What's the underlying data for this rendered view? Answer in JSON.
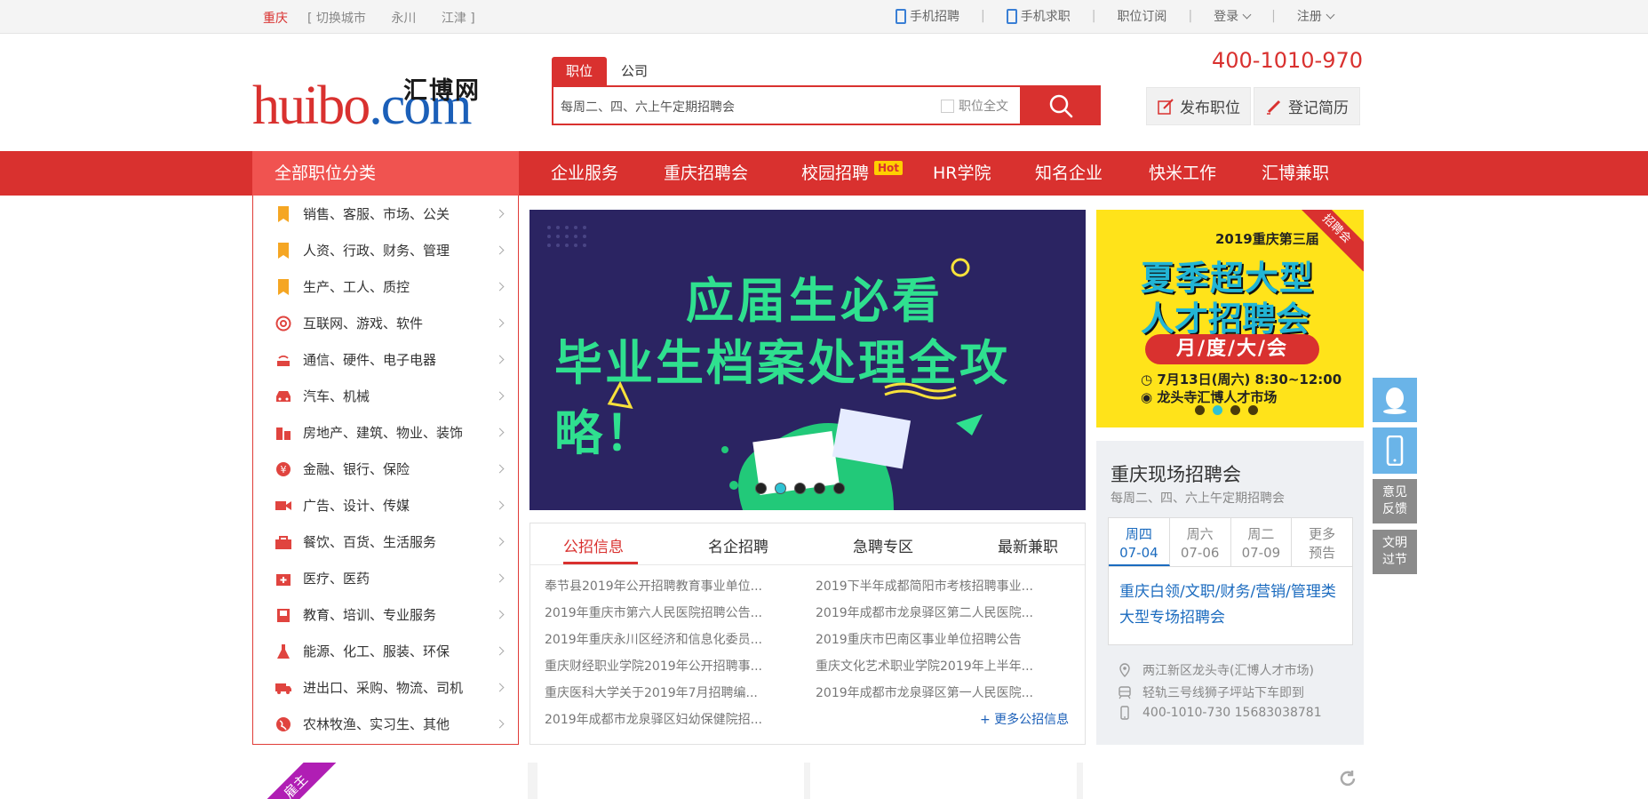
{
  "topbar": {
    "city": "重庆",
    "city_links": [
      "[ 切换城市",
      "永川",
      "江津 ]"
    ],
    "links": [
      "手机招聘",
      "手机求职",
      "职位订阅",
      "登录",
      "注册"
    ]
  },
  "logo": {
    "en_red": "huibo",
    "en_blue": ".com",
    "cn": "汇博网"
  },
  "search": {
    "tabs": [
      "职位",
      "公司"
    ],
    "query": "每周二、四、六上午定期招聘会",
    "fulltext_label": "职位全文"
  },
  "hotline": "400-1010-970",
  "header_buttons": {
    "post_job": "发布职位",
    "register_resume": "登记简历"
  },
  "nav": {
    "all_categories": "全部职位分类",
    "items": [
      "企业服务",
      "重庆招聘会",
      "校园招聘",
      "HR学院",
      "知名企业",
      "快米工作",
      "汇博兼职"
    ],
    "hot_badge": "Hot"
  },
  "categories": [
    "销售、客服、市场、公关",
    "人资、行政、财务、管理",
    "生产、工人、质控",
    "互联网、游戏、软件",
    "通信、硬件、电子电器",
    "汽车、机械",
    "房地产、建筑、物业、装饰",
    "金融、银行、保险",
    "广告、设计、传媒",
    "餐饮、百货、生活服务",
    "医疗、医药",
    "教育、培训、专业服务",
    "能源、化工、服装、环保",
    "进出口、采购、物流、司机",
    "农林牧渔、实习生、其他"
  ],
  "banner": {
    "line1": "应届生必看",
    "line2": "毕业生档案处理全攻略！"
  },
  "ad": {
    "title": "2019重庆第三届",
    "line2": "夏季超大型",
    "line3": "人才招聘会",
    "pill": "月/度/大/会",
    "time": "7月13日(周六) 8:30~12:00",
    "place": "龙头寺汇博人才市场",
    "ribbon": "招聘会"
  },
  "news": {
    "tabs": [
      "公招信息",
      "名企招聘",
      "急聘专区",
      "最新兼职"
    ],
    "left": [
      "奉节县2019年公开招聘教育事业单位...",
      "2019年重庆市第六人民医院招聘公告...",
      "2019年重庆永川区经济和信息化委员...",
      "重庆财经职业学院2019年公开招聘事...",
      "重庆医科大学关于2019年7月招聘编...",
      "2019年成都市龙泉驿区妇幼保健院招..."
    ],
    "right": [
      "2019下半年成都简阳市考核招聘事业...",
      "2019年成都市龙泉驿区第二人民医院...",
      "2019重庆市巴南区事业单位招聘公告",
      "重庆文化艺术职业学院2019年上半年...",
      "2019年成都市龙泉驿区第一人民医院..."
    ],
    "more": "+ 更多公招信息"
  },
  "fair": {
    "title": "重庆现场招聘会",
    "subtitle": "每周二、四、六上午定期招聘会",
    "days": [
      {
        "week": "周四",
        "date": "07-04"
      },
      {
        "week": "周六",
        "date": "07-06"
      },
      {
        "week": "周二",
        "date": "07-09"
      },
      {
        "week": "更多",
        "date": "预告"
      }
    ],
    "panel_text": "重庆白领/文职/财务/营销/管理类大型专场招聘会",
    "address": "两江新区龙头寺(汇博人才市场)",
    "transit": "轻轨三号线狮子坪站下车即到",
    "phone": "400-1010-730 15683038781"
  },
  "side": {
    "feedback": "意见反馈",
    "civil": "文明过节"
  },
  "bottom_badge": "雇主",
  "colors": {
    "brand_red": "#d9312f",
    "brand_blue": "#1b5fb8",
    "nav_light": "#f05350"
  }
}
